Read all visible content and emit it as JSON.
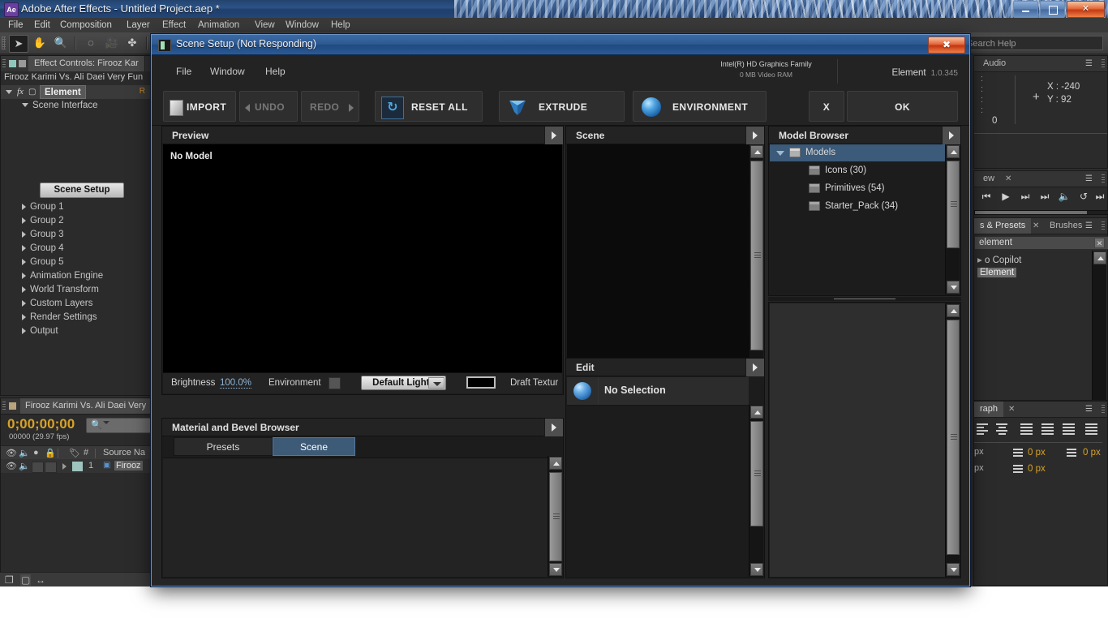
{
  "os_window": {
    "title": "Adobe After Effects - Untitled Project.aep *",
    "app_icon": "Ae",
    "minimize": "minimize-icon",
    "maximize": "restore-icon",
    "close": "✕"
  },
  "ae_menu": [
    "File",
    "Edit",
    "Composition",
    "Layer",
    "Effect",
    "Animation",
    "View",
    "Window",
    "Help"
  ],
  "ae_toolbar": {
    "tools": [
      "selection-tool",
      "hand-tool",
      "zoom-tool",
      "rotation-tool",
      "camera-tool",
      "pan-behind-tool"
    ],
    "glyphs": [
      "➤",
      "✋",
      "🔍",
      "◌",
      "🎥",
      "✤"
    ],
    "search_help_placeholder": "Search Help"
  },
  "effect_controls": {
    "tab_label": "Effect Controls: Firooz Kar",
    "comp_line": "Firooz Karimi Vs. Ali Daei Very Fun",
    "effect_name": "Element",
    "reset_label": "R",
    "rows": [
      {
        "label": "Scene Interface",
        "indent": 26,
        "open": true
      },
      {
        "label": "Group 1",
        "indent": 26,
        "open": false
      },
      {
        "label": "Group 2",
        "indent": 26,
        "open": false
      },
      {
        "label": "Group 3",
        "indent": 26,
        "open": false
      },
      {
        "label": "Group 4",
        "indent": 26,
        "open": false
      },
      {
        "label": "Group 5",
        "indent": 26,
        "open": false
      },
      {
        "label": "Animation Engine",
        "indent": 26,
        "open": false
      },
      {
        "label": "World Transform",
        "indent": 26,
        "open": false
      },
      {
        "label": "Custom Layers",
        "indent": 26,
        "open": false
      },
      {
        "label": "Render Settings",
        "indent": 26,
        "open": false
      },
      {
        "label": "Output",
        "indent": 26,
        "open": false
      }
    ],
    "scene_setup_button": "Scene Setup"
  },
  "timeline": {
    "tab_label": "Firooz Karimi Vs. Ali Daei Very",
    "timecode": "0;00;00;00",
    "frame_info": "00000 (29.97 fps)",
    "search_placeholder": "",
    "column_header": "Source Na",
    "layer_index": "1",
    "layer_name": "Firooz"
  },
  "right_dock": {
    "info": {
      "tab_label": "Audio",
      "x_label": "X : -240",
      "y_label": "Y : 92",
      "value_0": "0"
    },
    "preview": {
      "tab_label": "ew",
      "buttons": [
        "first-frame",
        "play",
        "next-frame",
        "last-frame",
        "mute",
        "loop",
        "ram-preview"
      ]
    },
    "effects": {
      "tab_label": "s & Presets",
      "tab_label_2": "Brushes",
      "search_value": "element",
      "folder": "o Copilot",
      "item": "Element"
    },
    "paragraph": {
      "tab_label": "raph",
      "indent_left": "0 px",
      "indent_right": "0 px",
      "indent_first": "0 px",
      "space_before": "0 px",
      "space_after": "0 px",
      "px_partial": "px"
    }
  },
  "dialog": {
    "title": "Scene Setup (Not Responding)",
    "close_label": "✖",
    "menu": [
      "File",
      "Window",
      "Help"
    ],
    "gpu": {
      "name": "Intel(R) HD Graphics Family",
      "vram": "0 MB Video RAM"
    },
    "product": {
      "name": "Element",
      "version": "1.0.345"
    },
    "toolbar": {
      "import": "IMPORT",
      "undo": "UNDO",
      "redo": "REDO",
      "reset_all": "RESET ALL",
      "extrude": "EXTRUDE",
      "environment": "ENVIRONMENT",
      "cancel": "X",
      "ok": "OK"
    },
    "preview": {
      "title": "Preview",
      "no_model": "No Model",
      "brightness_label": "Brightness",
      "brightness_value": "100.0%",
      "environment_label": "Environment",
      "lights_preset": "Default Lights",
      "background_color": "#000000",
      "draft_texture_label": "Draft Textur"
    },
    "material_browser": {
      "title": "Material and Bevel Browser",
      "tabs": [
        {
          "label": "Presets",
          "active": false
        },
        {
          "label": "Scene",
          "active": true
        }
      ]
    },
    "scene": {
      "title": "Scene"
    },
    "model_browser": {
      "title": "Model Browser",
      "tree": [
        {
          "label": "Models",
          "indent": 0,
          "selected": true,
          "expanded": true
        },
        {
          "label": "Icons (30)",
          "indent": 1,
          "selected": false,
          "expanded": false
        },
        {
          "label": "Primitives (54)",
          "indent": 1,
          "selected": false,
          "expanded": false
        },
        {
          "label": "Starter_Pack (34)",
          "indent": 1,
          "selected": false,
          "expanded": false
        }
      ]
    },
    "edit": {
      "title": "Edit",
      "selection": "No Selection"
    }
  },
  "colors": {
    "accent_blue": "#3c5a79",
    "tab_active": "#3d5a77",
    "timecode_orange": "#d9a227",
    "link_blue": "#8fb6d8",
    "dialog_border": "#6a93c8"
  }
}
